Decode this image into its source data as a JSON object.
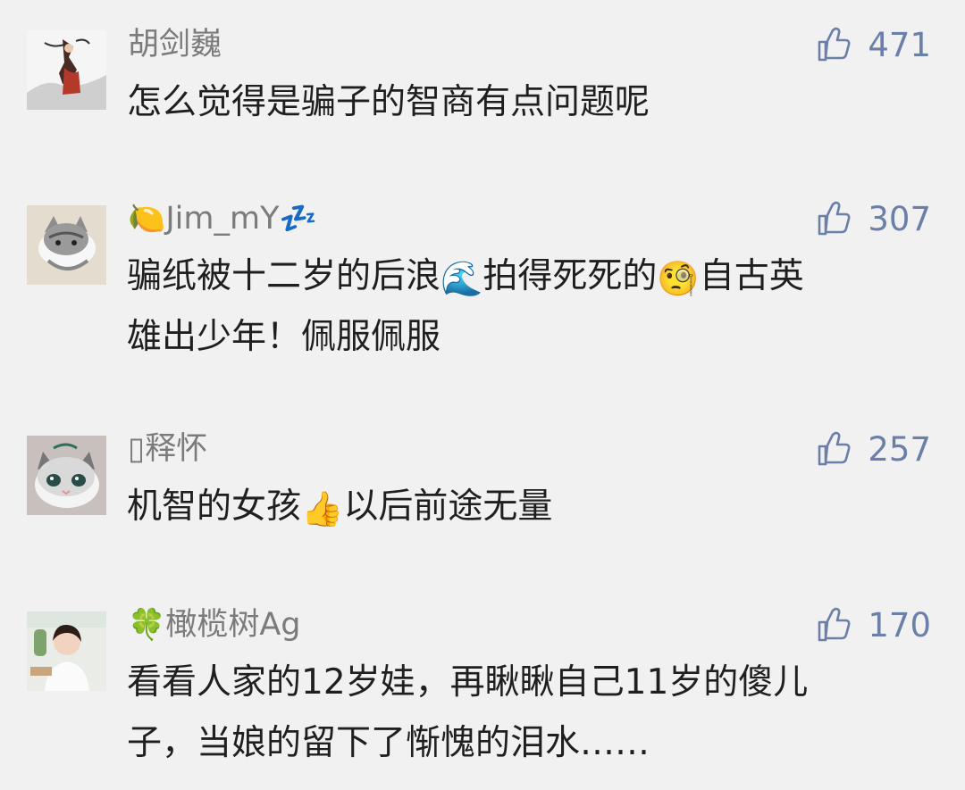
{
  "comments": [
    {
      "username": "胡剑巍",
      "likes": "471",
      "text_lines": [
        "怎么觉得是骗子的智商有点问题呢"
      ]
    },
    {
      "username_prefix_emoji": "🍋",
      "username": "Jim_mY",
      "username_suffix_emoji": "💤",
      "likes": "307",
      "text_line1_part1": "骗纸被十二岁的后浪",
      "text_line1_emoji1": "🌊",
      "text_line1_part2": "拍得死死的",
      "text_line1_emoji2": "🧐",
      "text_line1_part3": "自古英",
      "text_line2": "雄出少年！佩服佩服"
    },
    {
      "username": "▯释怀",
      "likes": "257",
      "text_part1": "机智的女孩",
      "text_emoji": "👍",
      "text_part2": "以后前途无量"
    },
    {
      "username_prefix_emoji": "🍀",
      "username": "橄榄树Ag",
      "likes": "170",
      "text_lines": [
        "看看人家的12岁娃，再瞅瞅自己11岁的傻儿",
        "子，当娘的留下了惭愧的泪水……"
      ]
    }
  ],
  "icons": {
    "like": "thumbs-up-outline-icon"
  },
  "colors": {
    "background": "#f1f1f1",
    "username": "#7b7b7b",
    "likes": "#6c7fa8",
    "text": "#1f1f1f"
  }
}
